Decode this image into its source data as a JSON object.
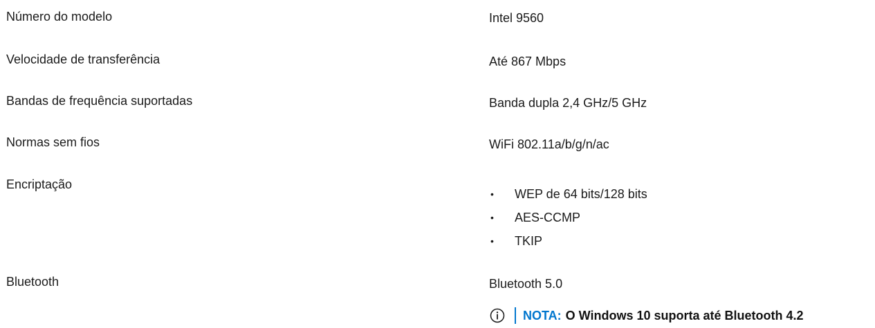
{
  "rows": [
    {
      "label": "Número do modelo",
      "value": "Intel 9560"
    },
    {
      "label": "Velocidade de transferência",
      "value": "Até 867 Mbps"
    },
    {
      "label": "Bandas de frequência suportadas",
      "value": "Banda dupla 2,4 GHz/5 GHz"
    },
    {
      "label": "Normas sem fios",
      "value": "WiFi 802.11a/b/g/n/ac"
    },
    {
      "label": "Encriptação",
      "bullets": [
        "WEP de 64 bits/128 bits",
        "AES-CCMP",
        "TKIP"
      ]
    },
    {
      "label": "Bluetooth",
      "value": "Bluetooth 5.0"
    }
  ],
  "note": {
    "icon": "info-icon",
    "keyword": "NOTA:",
    "text": "O Windows 10 suporta até Bluetooth 4.2",
    "accent_color": "#0076ce"
  },
  "bullet_glyph": "•"
}
